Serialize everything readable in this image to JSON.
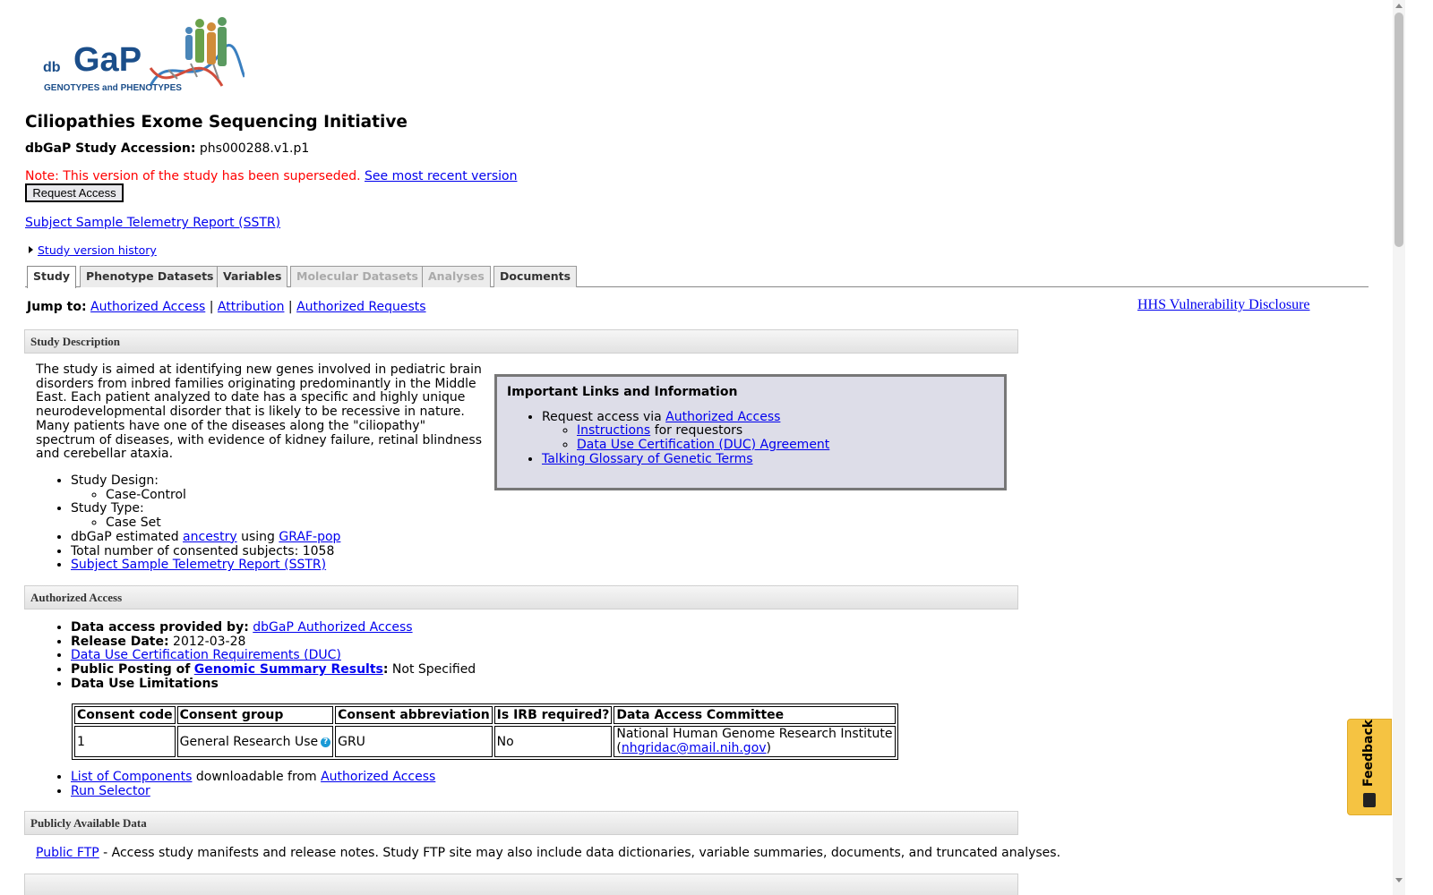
{
  "logo": {
    "db": "db",
    "gap": "GaP",
    "tagline": "GENOTYPES and PHENOTYPES"
  },
  "study": {
    "title": "Ciliopathies Exome Sequencing Initiative",
    "accession_label": "dbGaP Study Accession:",
    "accession_value": "phs000288.v1.p1",
    "superseded_note": "Note: This version of the study has been superseded.",
    "recent_version_link": "See most recent version",
    "request_access_button": "Request Access",
    "sstr_link": "Subject Sample Telemetry Report (SSTR)",
    "version_history_link": "Study version history"
  },
  "tabs": [
    {
      "label": "Study",
      "state": "active"
    },
    {
      "label": "Phenotype Datasets",
      "state": "enabled"
    },
    {
      "label": "Variables",
      "state": "enabled"
    },
    {
      "label": "Molecular Datasets",
      "state": "disabled"
    },
    {
      "label": "Analyses",
      "state": "disabled"
    },
    {
      "label": "Documents",
      "state": "enabled"
    }
  ],
  "jump": {
    "label": "Jump to:",
    "links": [
      "Authorized Access",
      "Attribution",
      "Authorized Requests"
    ],
    "separator": "|"
  },
  "hhs_link": "HHS Vulnerability Disclosure",
  "sections": {
    "description": "Study Description",
    "authorized": "Authorized Access",
    "public": "Publicly Available Data"
  },
  "description": {
    "text": "The study is aimed at identifying new genes involved in pediatric brain disorders from inbred families originating predominantly in the Middle East. Each patient analyzed to date has a specific and highly unique neurodevelopmental disorder that is likely to be recessive in nature. Many patients have one of the diseases along the \"ciliopathy\" spectrum of diseases, with evidence of kidney failure, retinal blindness and cerebellar ataxia.",
    "design_label": "Study Design:",
    "design_value": "Case-Control",
    "type_label": "Study Type:",
    "type_value": "Case Set",
    "ancestry_prefix": "dbGaP estimated",
    "ancestry_link": "ancestry",
    "ancestry_using": "using",
    "grafpop_link": "GRAF-pop",
    "subjects_text": "Total number of consented subjects: 1058",
    "sstr_link": "Subject Sample Telemetry Report (SSTR)"
  },
  "links_box": {
    "title": "Important Links and Information",
    "request_prefix": "Request access via",
    "request_link": "Authorized Access",
    "instructions_link": "Instructions",
    "instructions_suffix": "for requestors",
    "duc_link": "Data Use Certification (DUC) Agreement",
    "glossary_link": "Talking Glossary of Genetic Terms"
  },
  "authorized": {
    "provided_label": "Data access provided by:",
    "provided_link": "dbGaP Authorized Access",
    "release_label": "Release Date:",
    "release_value": "2012-03-28",
    "duc_req_link": "Data Use Certification Requirements (DUC)",
    "posting_label": "Public Posting of",
    "gsr_link": "Genomic Summary Results",
    "posting_colon": ":",
    "posting_value": "Not Specified",
    "limitations_label": "Data Use Limitations",
    "table": {
      "headers": [
        "Consent code",
        "Consent group",
        "Consent abbreviation",
        "Is IRB required?",
        "Data Access Committee"
      ],
      "row": {
        "code": "1",
        "group": "General Research Use",
        "abbrev": "GRU",
        "irb": "No",
        "dac_name": "National Human Genome Research Institute",
        "dac_email": "nhgridac@mail.nih.gov"
      }
    },
    "components_link": "List of Components",
    "components_mid": "downloadable from",
    "components_aa_link": "Authorized Access",
    "run_selector_link": "Run Selector"
  },
  "public": {
    "ftp_link": "Public FTP",
    "ftp_text": "- Access study manifests and release notes. Study FTP site may also include data dictionaries, variable summaries, documents, and truncated analyses."
  },
  "feedback": {
    "label": "Feedback",
    "icon": "feedback-icon"
  },
  "colors": {
    "note_red": "#ff0000",
    "link_blue": "#0000ee",
    "feedback_bg": "#f5c342",
    "links_box_bg": "#dddde8"
  }
}
